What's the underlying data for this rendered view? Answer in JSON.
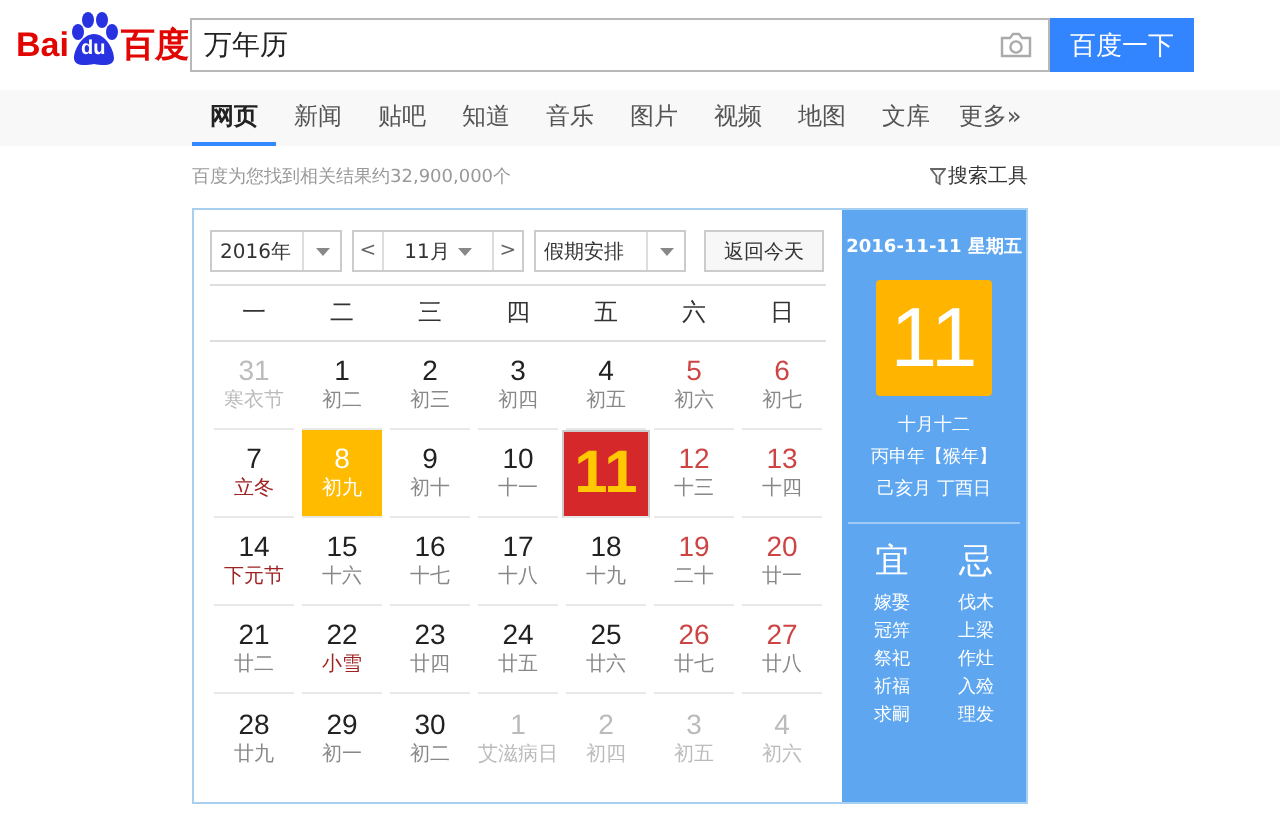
{
  "logo": {
    "left": "Bai",
    "paw": "du",
    "right": "百度"
  },
  "search": {
    "value": "万年历",
    "button": "百度一下"
  },
  "tabs": [
    {
      "label": "网页",
      "selected": true
    },
    {
      "label": "新闻",
      "selected": false
    },
    {
      "label": "贴吧",
      "selected": false
    },
    {
      "label": "知道",
      "selected": false
    },
    {
      "label": "音乐",
      "selected": false
    },
    {
      "label": "图片",
      "selected": false
    },
    {
      "label": "视频",
      "selected": false
    },
    {
      "label": "地图",
      "selected": false
    },
    {
      "label": "文库",
      "selected": false
    },
    {
      "label": "更多»",
      "selected": false
    }
  ],
  "result_count": "百度为您找到相关结果约32,900,000个",
  "search_tools": "搜索工具",
  "calendar": {
    "year": "2016年",
    "prev": "<",
    "month": "11月",
    "next": ">",
    "holidays": "假期安排",
    "today_button": "返回今天",
    "weekdays": [
      "一",
      "二",
      "三",
      "四",
      "五",
      "六",
      "日"
    ],
    "days": [
      {
        "day": "31",
        "lunar": "寒衣节",
        "kind": "other",
        "festival": false,
        "today": false,
        "selected": false
      },
      {
        "day": "1",
        "lunar": "初二",
        "kind": "weekday",
        "festival": false,
        "today": false,
        "selected": false
      },
      {
        "day": "2",
        "lunar": "初三",
        "kind": "weekday",
        "festival": false,
        "today": false,
        "selected": false
      },
      {
        "day": "3",
        "lunar": "初四",
        "kind": "weekday",
        "festival": false,
        "today": false,
        "selected": false
      },
      {
        "day": "4",
        "lunar": "初五",
        "kind": "weekday",
        "festival": false,
        "today": false,
        "selected": false
      },
      {
        "day": "5",
        "lunar": "初六",
        "kind": "weekend",
        "festival": false,
        "today": false,
        "selected": false
      },
      {
        "day": "6",
        "lunar": "初七",
        "kind": "weekend",
        "festival": false,
        "today": false,
        "selected": false
      },
      {
        "day": "7",
        "lunar": "立冬",
        "kind": "weekday",
        "festival": true,
        "today": false,
        "selected": false
      },
      {
        "day": "8",
        "lunar": "初九",
        "kind": "weekday",
        "festival": false,
        "today": true,
        "selected": false
      },
      {
        "day": "9",
        "lunar": "初十",
        "kind": "weekday",
        "festival": false,
        "today": false,
        "selected": false
      },
      {
        "day": "10",
        "lunar": "十一",
        "kind": "weekday",
        "festival": false,
        "today": false,
        "selected": false
      },
      {
        "day": "11",
        "kind": "weekday",
        "today": false,
        "selected": true
      },
      {
        "day": "12",
        "lunar": "十三",
        "kind": "weekend",
        "festival": false,
        "today": false,
        "selected": false
      },
      {
        "day": "13",
        "lunar": "十四",
        "kind": "weekend",
        "festival": false,
        "today": false,
        "selected": false
      },
      {
        "day": "14",
        "lunar": "下元节",
        "kind": "weekday",
        "festival": true,
        "today": false,
        "selected": false
      },
      {
        "day": "15",
        "lunar": "十六",
        "kind": "weekday",
        "festival": false,
        "today": false,
        "selected": false
      },
      {
        "day": "16",
        "lunar": "十七",
        "kind": "weekday",
        "festival": false,
        "today": false,
        "selected": false
      },
      {
        "day": "17",
        "lunar": "十八",
        "kind": "weekday",
        "festival": false,
        "today": false,
        "selected": false
      },
      {
        "day": "18",
        "lunar": "十九",
        "kind": "weekday",
        "festival": false,
        "today": false,
        "selected": false
      },
      {
        "day": "19",
        "lunar": "二十",
        "kind": "weekend",
        "festival": false,
        "today": false,
        "selected": false
      },
      {
        "day": "20",
        "lunar": "廿一",
        "kind": "weekend",
        "festival": false,
        "today": false,
        "selected": false
      },
      {
        "day": "21",
        "lunar": "廿二",
        "kind": "weekday",
        "festival": false,
        "today": false,
        "selected": false
      },
      {
        "day": "22",
        "lunar": "小雪",
        "kind": "weekday",
        "festival": true,
        "today": false,
        "selected": false
      },
      {
        "day": "23",
        "lunar": "廿四",
        "kind": "weekday",
        "festival": false,
        "today": false,
        "selected": false
      },
      {
        "day": "24",
        "lunar": "廿五",
        "kind": "weekday",
        "festival": false,
        "today": false,
        "selected": false
      },
      {
        "day": "25",
        "lunar": "廿六",
        "kind": "weekday",
        "festival": false,
        "today": false,
        "selected": false
      },
      {
        "day": "26",
        "lunar": "廿七",
        "kind": "weekend",
        "festival": false,
        "today": false,
        "selected": false
      },
      {
        "day": "27",
        "lunar": "廿八",
        "kind": "weekend",
        "festival": false,
        "today": false,
        "selected": false
      },
      {
        "day": "28",
        "lunar": "廿九",
        "kind": "weekday",
        "festival": false,
        "today": false,
        "selected": false
      },
      {
        "day": "29",
        "lunar": "初一",
        "kind": "weekday",
        "festival": false,
        "today": false,
        "selected": false
      },
      {
        "day": "30",
        "lunar": "初二",
        "kind": "weekday",
        "festival": false,
        "today": false,
        "selected": false
      },
      {
        "day": "1",
        "lunar": "艾滋病日",
        "kind": "other",
        "festival": false,
        "today": false,
        "selected": false
      },
      {
        "day": "2",
        "lunar": "初四",
        "kind": "other",
        "festival": false,
        "today": false,
        "selected": false
      },
      {
        "day": "3",
        "lunar": "初五",
        "kind": "other",
        "festival": false,
        "today": false,
        "selected": false
      },
      {
        "day": "4",
        "lunar": "初六",
        "kind": "other",
        "festival": false,
        "today": false,
        "selected": false
      }
    ]
  },
  "detail": {
    "date": "2016-11-11 星期五",
    "day": "11",
    "lunar": "十月十二",
    "year": "丙申年【猴年】",
    "month_day": "己亥月 丁酉日",
    "suitable": {
      "title": "宜",
      "items": [
        "嫁娶",
        "冠笄",
        "祭祀",
        "祈福",
        "求嗣"
      ]
    },
    "avoid": {
      "title": "忌",
      "items": [
        "伐木",
        "上梁",
        "作灶",
        "入殓",
        "理发"
      ]
    }
  }
}
